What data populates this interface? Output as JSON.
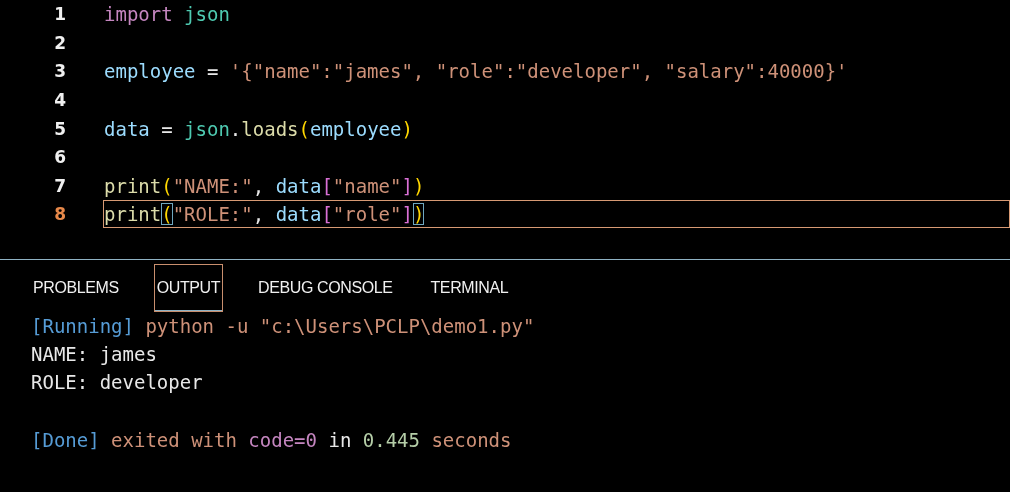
{
  "editor": {
    "lines": [
      {
        "number": "1",
        "current": false,
        "bracket_match": false,
        "tokens": [
          {
            "kind": "keyword",
            "text": "import "
          },
          {
            "kind": "module",
            "text": "json"
          }
        ]
      },
      {
        "number": "2",
        "current": false
      },
      {
        "number": "3",
        "current": false,
        "bracket_match": false,
        "tokens": [
          {
            "kind": "variable",
            "text": "employee"
          },
          {
            "kind": "plain",
            "text": " = "
          },
          {
            "kind": "string",
            "text": "'{\"name\":\"james\", \"role\":\"developer\", \"salary\":40000}'"
          }
        ]
      },
      {
        "number": "4",
        "current": false
      },
      {
        "number": "5",
        "current": false,
        "bracket_match": false,
        "tokens": [
          {
            "kind": "variable",
            "text": "data"
          },
          {
            "kind": "plain",
            "text": " = "
          },
          {
            "kind": "module",
            "text": "json"
          },
          {
            "kind": "plain",
            "text": "."
          },
          {
            "kind": "function",
            "text": "loads"
          },
          {
            "kind": "paren",
            "text": "("
          },
          {
            "kind": "variable",
            "text": "employee"
          },
          {
            "kind": "paren",
            "text": ")"
          }
        ]
      },
      {
        "number": "6",
        "current": false
      },
      {
        "number": "7",
        "current": false,
        "bracket_match": false,
        "tokens": [
          {
            "kind": "function",
            "text": "print"
          },
          {
            "kind": "paren",
            "text": "("
          },
          {
            "kind": "string",
            "text": "\"NAME:\""
          },
          {
            "kind": "plain",
            "text": ", "
          },
          {
            "kind": "variable",
            "text": "data"
          },
          {
            "kind": "bracket",
            "text": "["
          },
          {
            "kind": "string",
            "text": "\"name\""
          },
          {
            "kind": "bracket",
            "text": "]"
          },
          {
            "kind": "paren",
            "text": ")"
          }
        ]
      },
      {
        "number": "8",
        "current": true,
        "bracket_match": true,
        "tokens": [
          {
            "kind": "function",
            "text": "print"
          },
          {
            "kind": "paren",
            "text": "("
          },
          {
            "kind": "string",
            "text": "\"ROLE:\""
          },
          {
            "kind": "plain",
            "text": ", "
          },
          {
            "kind": "variable",
            "text": "data"
          },
          {
            "kind": "bracket",
            "text": "["
          },
          {
            "kind": "string",
            "text": "\"role\""
          },
          {
            "kind": "bracket",
            "text": "]"
          },
          {
            "kind": "paren",
            "text": ")"
          }
        ]
      }
    ]
  },
  "panel": {
    "tabs": [
      {
        "label": "PROBLEMS",
        "selected": false
      },
      {
        "label": "OUTPUT",
        "selected": true
      },
      {
        "label": "DEBUG CONSOLE",
        "selected": false
      },
      {
        "label": "TERMINAL",
        "selected": false
      }
    ],
    "output": {
      "run": [
        [
          {
            "kind": "tag",
            "text": "[Running]"
          },
          {
            "kind": "string",
            "text": " python -u \"c:\\Users\\PCLP\\demo1.py\""
          }
        ],
        [
          {
            "kind": "plain",
            "text": "NAME: james"
          }
        ],
        [
          {
            "kind": "plain",
            "text": "ROLE: developer"
          }
        ]
      ],
      "result": [
        [
          {
            "kind": "tag",
            "text": "[Done]"
          },
          {
            "kind": "string",
            "text": " exited with "
          },
          {
            "kind": "keyword",
            "text": "code=0"
          },
          {
            "kind": "plain",
            "text": " in "
          },
          {
            "kind": "number",
            "text": "0.445"
          },
          {
            "kind": "string",
            "text": " seconds"
          }
        ]
      ]
    }
  }
}
